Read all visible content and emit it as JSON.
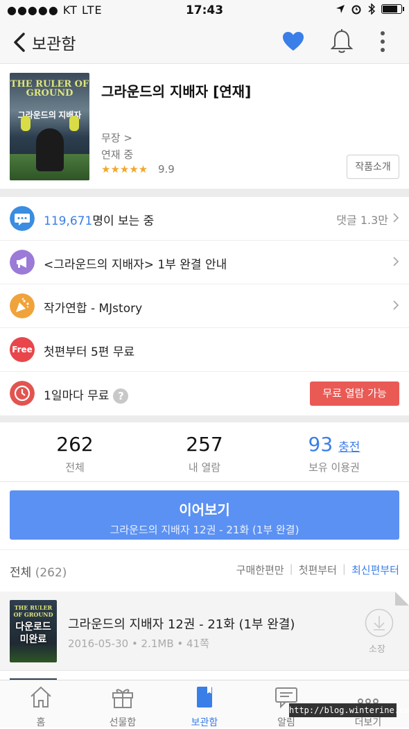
{
  "status_bar": {
    "carrier": "●●●●● KT   LTE",
    "time": "17:43"
  },
  "nav": {
    "title": "보관함"
  },
  "book": {
    "title": "그라운드의 지배자 [연재]",
    "author": "무장 >",
    "state": "연재 중",
    "stars": "★★★★★",
    "score": "9.9",
    "intro_button": "작품소개",
    "cover_title": "THE RULER OF GROUND",
    "cover_subtitle": "그라운드의 지배자"
  },
  "info_rows": {
    "viewers_count": "119,671",
    "viewers_suffix": "명이 보는 중",
    "comments": "댓글 1.3만",
    "notice": "<그라운드의 지배자> 1부 완결 안내",
    "publisher": "작가연합 - MJstory",
    "free_icon": "Free",
    "free_episodes": "첫편부터 5편 무료",
    "daily_free": "1일마다 무료",
    "daily_free_help": "?",
    "free_open_button": "무료 열람 가능"
  },
  "stats": {
    "total_value": "262",
    "total_label": "전체",
    "read_value": "257",
    "read_label": "내 열람",
    "tickets_value": "93",
    "charge_label": "충전",
    "tickets_label": "보유 이용권"
  },
  "continue": {
    "label": "이어보기",
    "sub": "그라운드의 지배자 12권 - 21화 (1부 완결)"
  },
  "list_header": {
    "total": "전체",
    "count": "(262)",
    "filters": [
      "구매한편만",
      "첫편부터",
      "최신편부터"
    ],
    "separator": "|"
  },
  "list": [
    {
      "title": "그라운드의 지배자 12권 - 21화 (1부 완결)",
      "meta": "2016-05-30 • 2.1MB • 41쪽",
      "thumb_overlay_line1": "다운로드",
      "thumb_overlay_line2": "미완료",
      "thumb_title": "THE RULER OF GROUND",
      "action": "소장"
    }
  ],
  "tabs": [
    {
      "label": "홈",
      "icon": "home-icon"
    },
    {
      "label": "선물함",
      "icon": "gift-icon"
    },
    {
      "label": "보관함",
      "icon": "library-icon"
    },
    {
      "label": "알림",
      "icon": "message-icon"
    },
    {
      "label": "더보기",
      "icon": "more-icon"
    }
  ],
  "watermark": "http://blog.winterine.com",
  "colors": {
    "accent": "#3a7ee8",
    "heart": "#3a7ee8",
    "free_red": "#ea5a55",
    "continue_blue": "#5b91f2"
  }
}
